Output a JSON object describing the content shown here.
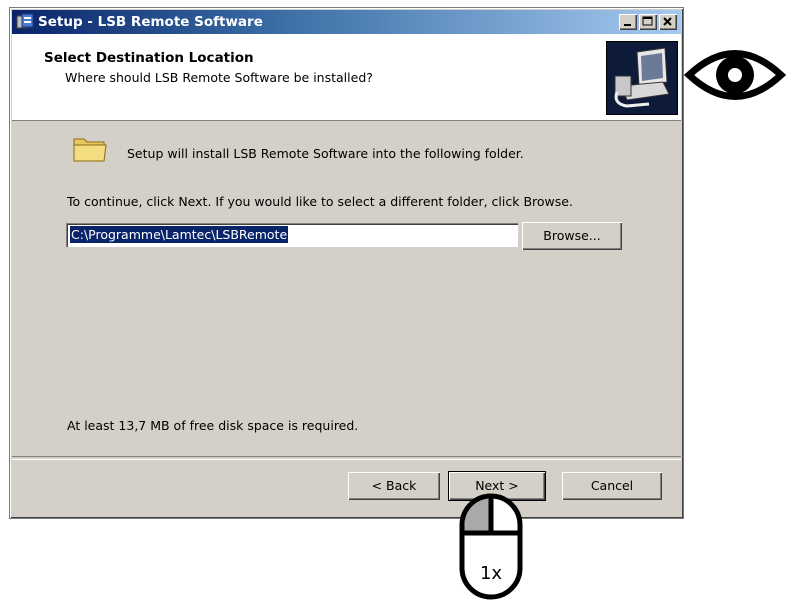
{
  "window": {
    "title": "Setup - LSB Remote Software"
  },
  "header": {
    "title": "Select Destination Location",
    "subtitle": "Where should LSB Remote Software be installed?"
  },
  "content": {
    "install_text": "Setup will install LSB Remote Software into the following folder.",
    "continue_text": "To continue, click Next. If you would like to select a different folder, click Browse.",
    "path_value": "C:\\Programme\\Lamtec\\LSBRemote",
    "browse_label": "Browse...",
    "space_text": "At least 13,7 MB of free disk space is required."
  },
  "footer": {
    "back_label": "< Back",
    "next_label": "Next >",
    "cancel_label": "Cancel"
  },
  "annotation": {
    "click_count": "1x"
  },
  "icons": [
    "app-icon",
    "minimize-icon",
    "maximize-icon",
    "close-icon",
    "computer-install-icon",
    "folder-icon",
    "eye-icon",
    "mouse-icon"
  ]
}
